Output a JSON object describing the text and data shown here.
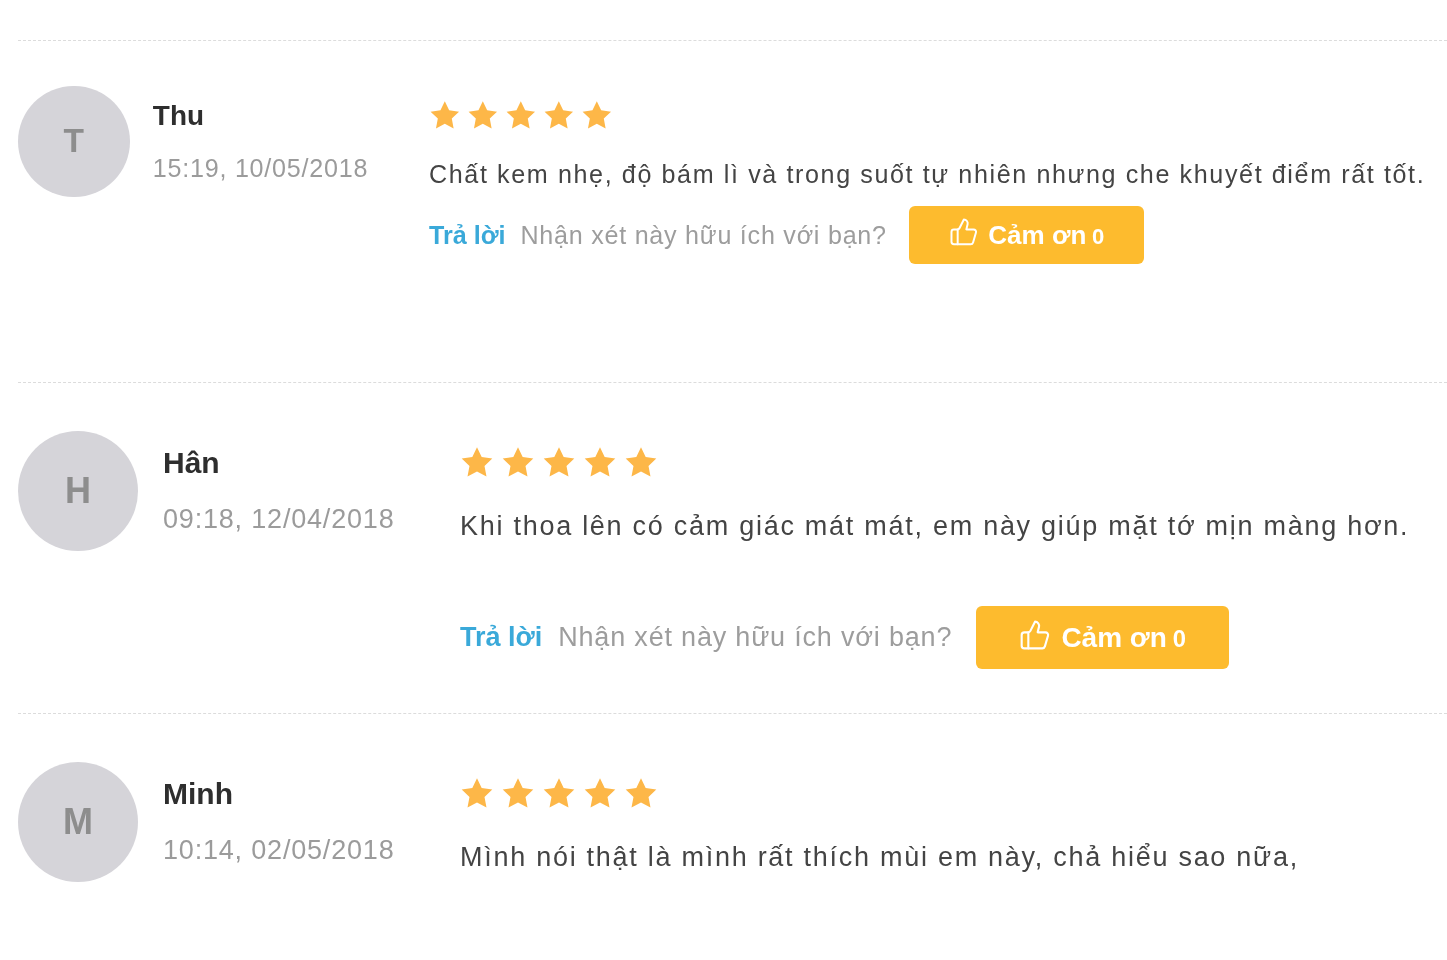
{
  "reviews": [
    {
      "avatar_letter": "T",
      "name": "Thu",
      "time": "15:19, 10/05/2018",
      "stars": 5,
      "comment": "Chất kem nhẹ, độ bám lì và trong suốt tự nhiên nhưng che khuyết điểm rất tốt.",
      "reply_link": "Trả lời",
      "helpful_prompt": "Nhận xét này hữu ích với bạn?",
      "thanks_button": {
        "label": "Cảm ơn",
        "count": "0"
      }
    },
    {
      "avatar_letter": "H",
      "name": "Hân",
      "time": "09:18, 12/04/2018",
      "stars": 5,
      "comment": "Khi thoa lên có cảm giác mát mát, em này giúp mặt tớ mịn màng hơn.",
      "reply_link": "Trả lời",
      "helpful_prompt": "Nhận xét này hữu ích với bạn?",
      "thanks_button": {
        "label": "Cảm ơn",
        "count": "0"
      }
    },
    {
      "avatar_letter": "M",
      "name": "Minh",
      "time": "10:14, 02/05/2018",
      "stars": 5,
      "comment": "Mình nói thật là mình rất thích mùi em này, chả hiểu sao nữa,"
    }
  ]
}
